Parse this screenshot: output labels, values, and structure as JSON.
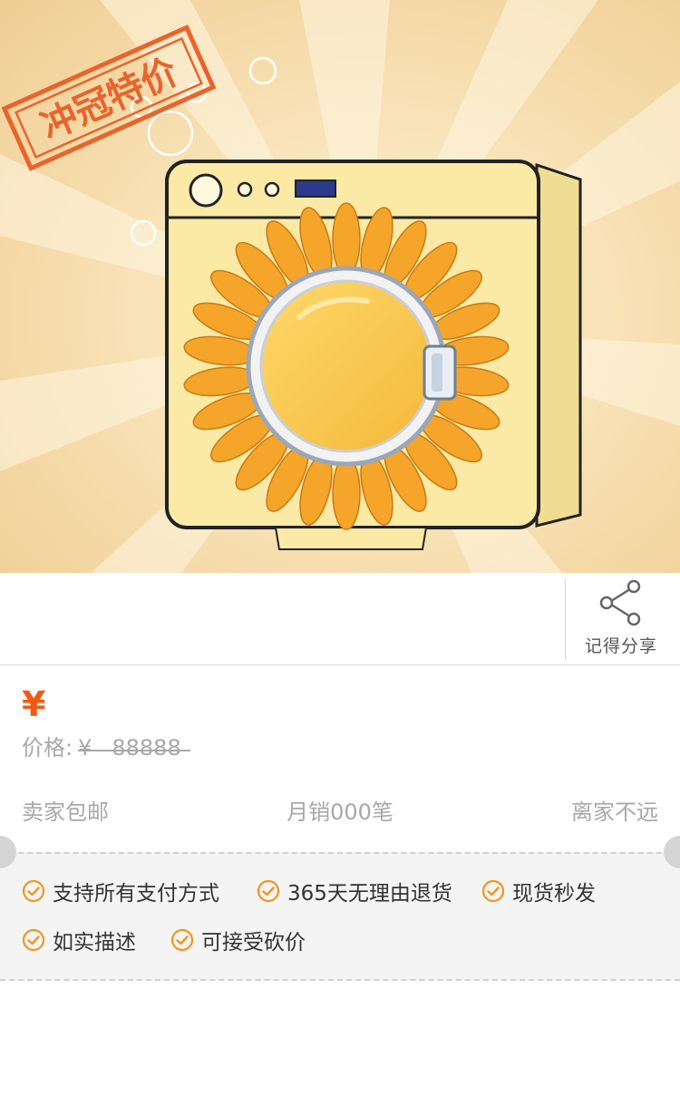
{
  "hero": {
    "stamp_text": "冲冠特价",
    "accent": "#e8642c"
  },
  "share": {
    "label": "记得分享",
    "icon": "share-icon"
  },
  "price": {
    "currency_symbol": "¥",
    "current_value": "",
    "original_label": "价格:",
    "original_currency": "¥",
    "original_value": "88888",
    "color": "#f05a14"
  },
  "meta": {
    "shipping": "卖家包邮",
    "sales": "月销000笔",
    "distance": "离家不远"
  },
  "services": {
    "icon": "check-circle-icon",
    "color": "#f0961e",
    "items": [
      {
        "label": "支持所有支付方式"
      },
      {
        "label": "365天无理由退货"
      },
      {
        "label": "现货秒发"
      },
      {
        "label": "如实描述"
      },
      {
        "label": "可接受砍价"
      }
    ]
  }
}
